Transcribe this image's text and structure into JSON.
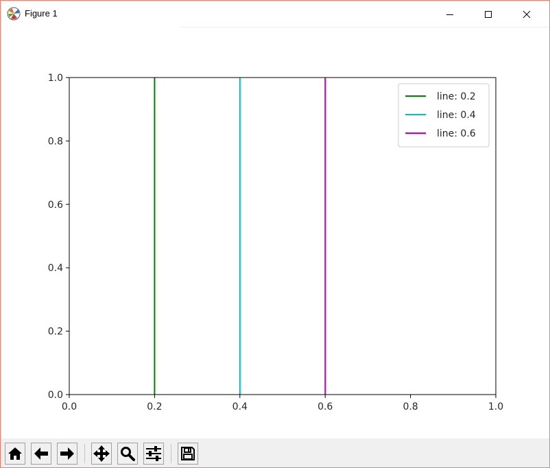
{
  "window": {
    "title": "Figure 1",
    "icons": {
      "app": "matplotlib-icon",
      "minimize": "minimize-icon",
      "maximize": "maximize-icon",
      "close": "close-icon"
    }
  },
  "toolbar": {
    "buttons": [
      {
        "name": "home",
        "icon": "home-icon"
      },
      {
        "name": "back",
        "icon": "arrow-left-icon"
      },
      {
        "name": "forward",
        "icon": "arrow-right-icon"
      },
      {
        "name": "pan",
        "icon": "move-icon"
      },
      {
        "name": "zoom",
        "icon": "magnifier-icon"
      },
      {
        "name": "configure-subplots",
        "icon": "sliders-icon"
      },
      {
        "name": "save",
        "icon": "floppy-disk-icon"
      }
    ]
  },
  "chart_data": {
    "type": "line",
    "title": "",
    "xlabel": "",
    "ylabel": "",
    "xlim": [
      0.0,
      1.0
    ],
    "ylim": [
      0.0,
      1.0
    ],
    "xticks": [
      "0.0",
      "0.2",
      "0.4",
      "0.6",
      "0.8",
      "1.0"
    ],
    "yticks": [
      "0.0",
      "0.2",
      "0.4",
      "0.6",
      "0.8",
      "1.0"
    ],
    "grid": false,
    "legend_position": "upper-right",
    "series": [
      {
        "name": "line: 0.2",
        "color": "#008000",
        "x": [
          0.2,
          0.2
        ],
        "y": [
          0.0,
          1.0
        ]
      },
      {
        "name": "line: 0.4",
        "color": "#00bfbf",
        "x": [
          0.4,
          0.4
        ],
        "y": [
          0.0,
          1.0
        ]
      },
      {
        "name": "line: 0.6",
        "color": "#bf00bf",
        "x": [
          0.6,
          0.6
        ],
        "y": [
          0.0,
          1.0
        ]
      }
    ]
  }
}
